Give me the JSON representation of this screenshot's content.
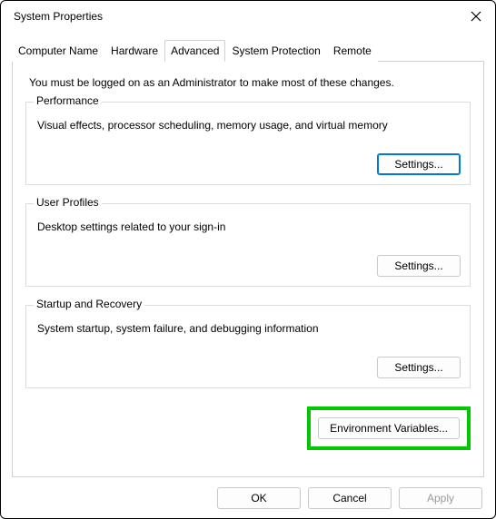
{
  "titlebar": {
    "title": "System Properties"
  },
  "tabs": {
    "items": [
      {
        "label": "Computer Name"
      },
      {
        "label": "Hardware"
      },
      {
        "label": "Advanced"
      },
      {
        "label": "System Protection"
      },
      {
        "label": "Remote"
      }
    ],
    "activeIndex": 2
  },
  "panel": {
    "intro": "You must be logged on as an Administrator to make most of these changes.",
    "groups": [
      {
        "legend": "Performance",
        "desc": "Visual effects, processor scheduling, memory usage, and virtual memory",
        "button": "Settings..."
      },
      {
        "legend": "User Profiles",
        "desc": "Desktop settings related to your sign-in",
        "button": "Settings..."
      },
      {
        "legend": "Startup and Recovery",
        "desc": "System startup, system failure, and debugging information",
        "button": "Settings..."
      }
    ],
    "envVars": {
      "button": "Environment Variables..."
    }
  },
  "bottomButtons": {
    "ok": "OK",
    "cancel": "Cancel",
    "apply": "Apply"
  }
}
